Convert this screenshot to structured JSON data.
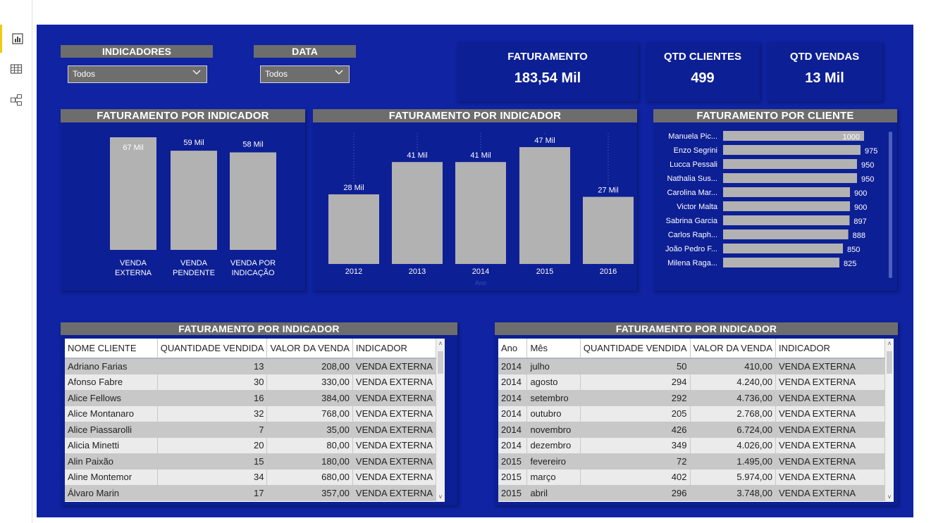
{
  "rail": {
    "items": [
      {
        "name": "report-view-icon"
      },
      {
        "name": "data-view-icon"
      },
      {
        "name": "model-view-icon"
      }
    ]
  },
  "slicers": {
    "indicadores": {
      "title": "INDICADORES",
      "value": "Todos"
    },
    "data": {
      "title": "DATA",
      "value": "Todos"
    }
  },
  "cards": {
    "faturamento": {
      "title": "FATURAMENTO",
      "value": "183,54 Mil"
    },
    "clientes": {
      "title": "QTD CLIENTES",
      "value": "499"
    },
    "vendas": {
      "title": "QTD VENDAS",
      "value": "13 Mil"
    }
  },
  "chart_data": [
    {
      "type": "bar",
      "title": "FATURAMENTO POR INDICADOR",
      "categories": [
        [
          "VENDA",
          "EXTERNA"
        ],
        [
          "VENDA",
          "PENDENTE"
        ],
        [
          "VENDA POR",
          "INDICAÇÃO"
        ]
      ],
      "values": [
        67,
        59,
        58
      ],
      "labels": [
        "67 Mil",
        "59 Mil",
        "58 Mil"
      ],
      "ylim": [
        0,
        67
      ],
      "color": "#b2b2b2"
    },
    {
      "type": "bar",
      "title": "FATURAMENTO POR INDICADOR",
      "categories": [
        "2012",
        "2013",
        "2014",
        "2015",
        "2016"
      ],
      "values": [
        28,
        41,
        41,
        47,
        27
      ],
      "labels": [
        "28 Mil",
        "41 Mil",
        "41 Mil",
        "47 Mil",
        "27 Mil"
      ],
      "xlabel": "Ano",
      "ylim": [
        0,
        47
      ],
      "color": "#b2b2b2"
    },
    {
      "type": "bar",
      "orientation": "horizontal",
      "title": "FATURAMENTO POR CLIENTE",
      "categories": [
        "Manuela Pic...",
        "Enzo Segrini",
        "Lucca Pessali",
        "Nathalia Sus...",
        "Carolina Mar...",
        "Victor Malta",
        "Sabrina Garcia",
        "Carlos Raph...",
        "João Pedro F...",
        "Milena Raga..."
      ],
      "values": [
        1000,
        975,
        950,
        950,
        900,
        900,
        897,
        888,
        850,
        825
      ],
      "labels": [
        "1000",
        "975",
        "950",
        "950",
        "900",
        "900",
        "897",
        "888",
        "850",
        "825"
      ],
      "xlim": [
        0,
        1000
      ],
      "color": "#b2b2b2"
    }
  ],
  "table1": {
    "title": "FATURAMENTO POR INDICADOR",
    "columns": [
      "NOME CLIENTE",
      "QUANTIDADE VENDIDA",
      "VALOR DA VENDA",
      "INDICADOR"
    ],
    "rows": [
      [
        "Adriano Farias",
        "13",
        "208,00",
        "VENDA EXTERNA"
      ],
      [
        "Afonso Fabre",
        "30",
        "330,00",
        "VENDA EXTERNA"
      ],
      [
        "Alice Fellows",
        "16",
        "384,00",
        "VENDA EXTERNA"
      ],
      [
        "Alice Montanaro",
        "32",
        "768,00",
        "VENDA EXTERNA"
      ],
      [
        "Alice Piassarolli",
        "7",
        "35,00",
        "VENDA EXTERNA"
      ],
      [
        "Alicia Minetti",
        "20",
        "80,00",
        "VENDA EXTERNA"
      ],
      [
        "Alin Paixão",
        "15",
        "180,00",
        "VENDA EXTERNA"
      ],
      [
        "Aline Montemor",
        "34",
        "680,00",
        "VENDA EXTERNA"
      ],
      [
        "Álvaro Marin",
        "17",
        "357,00",
        "VENDA EXTERNA"
      ]
    ]
  },
  "table2": {
    "title": "FATURAMENTO POR INDICADOR",
    "columns": [
      "Ano",
      "Mês",
      "QUANTIDADE VENDIDA",
      "VALOR DA VENDA",
      "INDICADOR"
    ],
    "rows": [
      [
        "2014",
        "julho",
        "50",
        "410,00",
        "VENDA EXTERNA"
      ],
      [
        "2014",
        "agosto",
        "294",
        "4.240,00",
        "VENDA EXTERNA"
      ],
      [
        "2014",
        "setembro",
        "292",
        "4.736,00",
        "VENDA EXTERNA"
      ],
      [
        "2014",
        "outubro",
        "205",
        "2.768,00",
        "VENDA EXTERNA"
      ],
      [
        "2014",
        "novembro",
        "426",
        "6.724,00",
        "VENDA EXTERNA"
      ],
      [
        "2014",
        "dezembro",
        "349",
        "4.026,00",
        "VENDA EXTERNA"
      ],
      [
        "2015",
        "fevereiro",
        "72",
        "1.495,00",
        "VENDA EXTERNA"
      ],
      [
        "2015",
        "março",
        "402",
        "5.974,00",
        "VENDA EXTERNA"
      ],
      [
        "2015",
        "abril",
        "296",
        "3.748,00",
        "VENDA EXTERNA"
      ]
    ]
  }
}
